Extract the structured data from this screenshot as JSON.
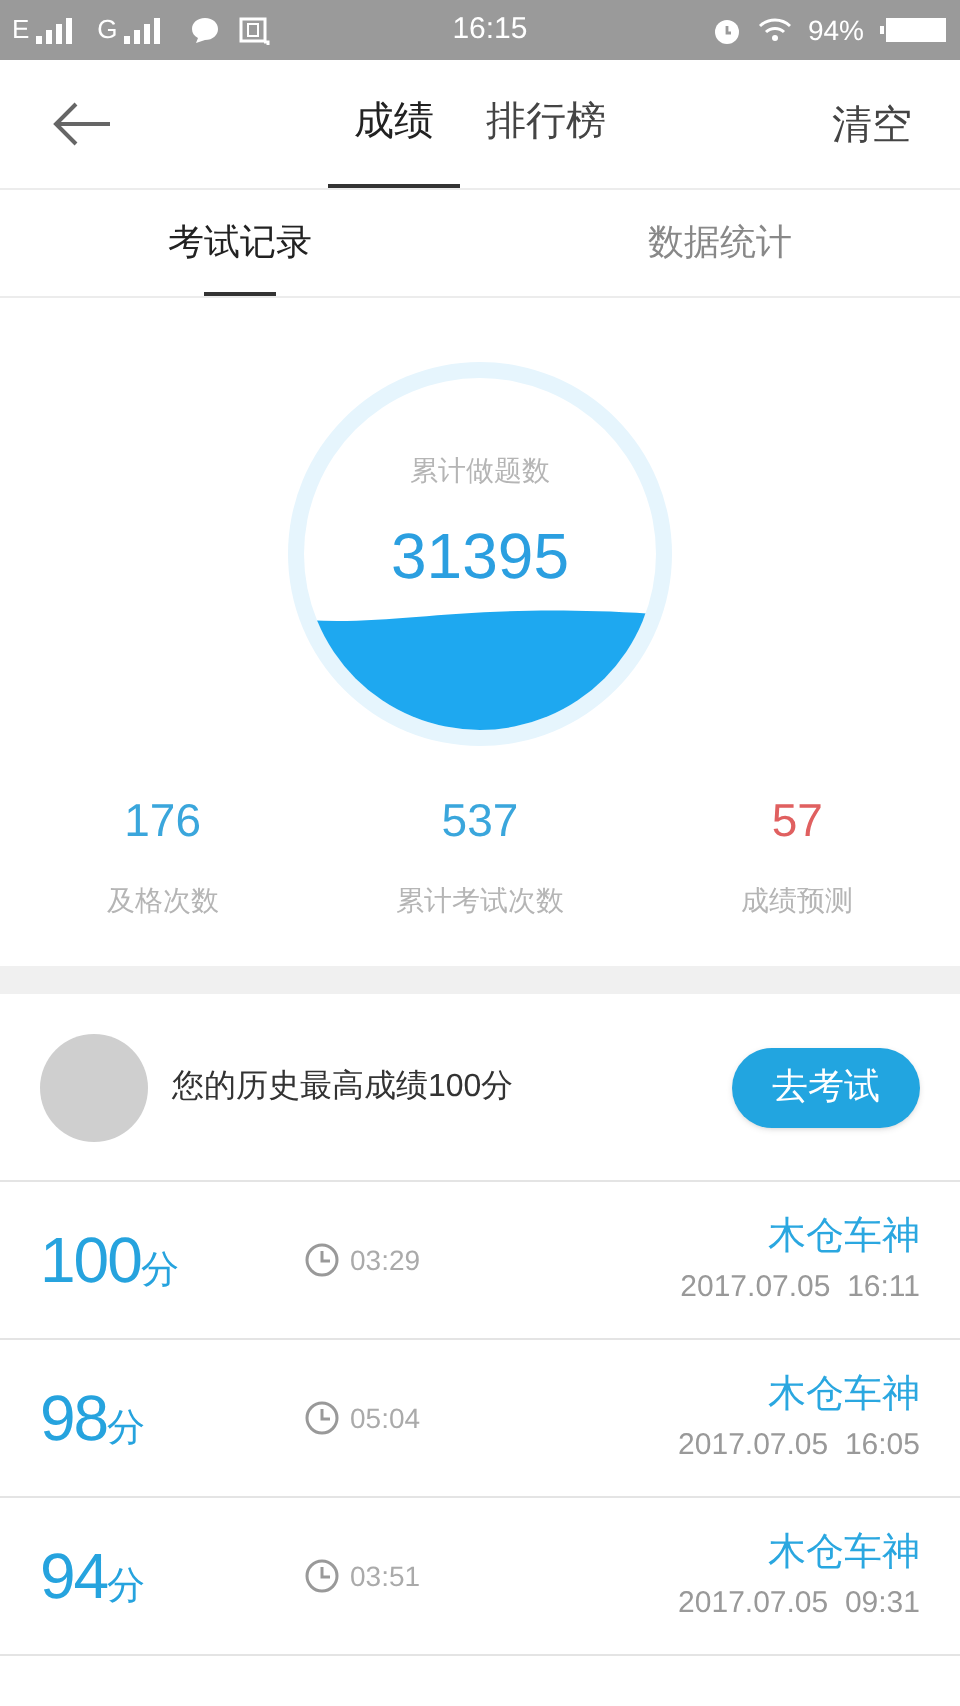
{
  "status_bar": {
    "network_1": "E",
    "network_2": "G",
    "time": "16:15",
    "battery": "94%"
  },
  "nav": {
    "tabs": [
      {
        "label": "成绩",
        "selected": true
      },
      {
        "label": "排行榜",
        "selected": false
      }
    ],
    "action": "清空"
  },
  "sub_tabs": [
    {
      "label": "考试记录",
      "selected": true
    },
    {
      "label": "数据统计",
      "selected": false
    }
  ],
  "total": {
    "label": "累计做题数",
    "value": "31395"
  },
  "stats": [
    {
      "value": "176",
      "label": "及格次数",
      "color": "#3aa6dc"
    },
    {
      "value": "537",
      "label": "累计考试次数",
      "color": "#3aa6dc"
    },
    {
      "value": "57",
      "label": "成绩预测",
      "color": "#e06060"
    }
  ],
  "best": {
    "text": "您的历史最高成绩100分",
    "button": "去考试"
  },
  "records": [
    {
      "score": "100",
      "unit": "分",
      "duration": "03:29",
      "name": "木仓车神",
      "date": "2017.07.05  16:11"
    },
    {
      "score": "98",
      "unit": "分",
      "duration": "05:04",
      "name": "木仓车神",
      "date": "2017.07.05  16:05"
    },
    {
      "score": "94",
      "unit": "分",
      "duration": "03:51",
      "name": "木仓车神",
      "date": "2017.07.05  09:31"
    }
  ]
}
